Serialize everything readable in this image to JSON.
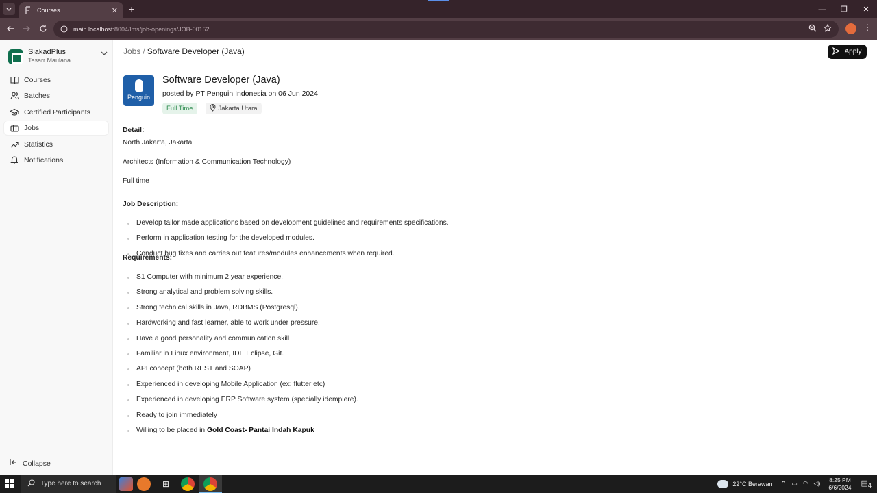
{
  "browser": {
    "tab_title": "Courses",
    "tab_close": "✕",
    "new_tab": "+",
    "url_host": "main.localhost",
    "url_rest": ":8004/lms/job-openings/JOB-00152",
    "win_min": "—",
    "win_restore": "❐",
    "win_close": "✕"
  },
  "sidebar": {
    "brand_name": "SiakadPlus",
    "brand_user": "Tesarr Maulana",
    "items": [
      {
        "label": "Courses",
        "icon": "book-icon"
      },
      {
        "label": "Batches",
        "icon": "users-icon"
      },
      {
        "label": "Certified Participants",
        "icon": "graduation-cap-icon"
      },
      {
        "label": "Jobs",
        "icon": "briefcase-icon"
      },
      {
        "label": "Statistics",
        "icon": "trending-up-icon"
      },
      {
        "label": "Notifications",
        "icon": "bell-icon"
      }
    ],
    "active_item": "Jobs",
    "collapse_label": "Collapse"
  },
  "header": {
    "crumb_root": "Jobs",
    "crumb_sep": "/",
    "crumb_current": "Software Developer (Java)",
    "apply_label": "Apply"
  },
  "job": {
    "logo_text": "Penguin",
    "title": "Software Developer (Java)",
    "posted_prefix": "posted by",
    "company": "PT Penguin Indonesia",
    "posted_on": "on",
    "date": "06 Jun 2024",
    "type_tag": "Full Time",
    "location_tag": "Jakarta Utara",
    "detail_heading": "Detail:",
    "detail_lines": [
      "North Jakarta, Jakarta",
      "Architects (Information & Communication Technology)",
      "Full time"
    ],
    "description_heading": "Job Description:",
    "description_items": [
      "Develop tailor made applications based on development guidelines and requirements specifications.",
      "Perform in application testing for the developed modules.",
      "Conduct bug fixes and carries out features/modules enhancements when required."
    ],
    "requirements_heading": "Requirements:",
    "requirements_items": [
      "S1 Computer with minimum 2 year experience.",
      "Strong analytical and problem solving skills.",
      "Strong technical skills in Java, RDBMS (Postgresql).",
      "Hardworking and fast learner, able to work under pressure.",
      "Have a good personality and communication skill",
      "Familiar in Linux environment, IDE Eclipse, Git.",
      "API concept (both REST and SOAP)",
      "Experienced in developing Mobile Application (ex: flutter etc)",
      "Experienced in developing ERP Software system (specially idempiere).",
      "Ready to join immediately"
    ],
    "last_requirement_prefix": "Willing to be placed in",
    "last_requirement_bold": "Gold Coast- Pantai Indah Kapuk"
  },
  "taskbar": {
    "search_placeholder": "Type here to search",
    "weather": "22°C  Berawan",
    "time": "8:25 PM",
    "date": "6/6/2024",
    "notif_count": "4"
  },
  "colors": {
    "accent_green": "#0f6f4e",
    "tag_green_bg": "#e5f3ea",
    "tag_green_text": "#2b8a4c",
    "chrome_frame": "#533e45"
  }
}
